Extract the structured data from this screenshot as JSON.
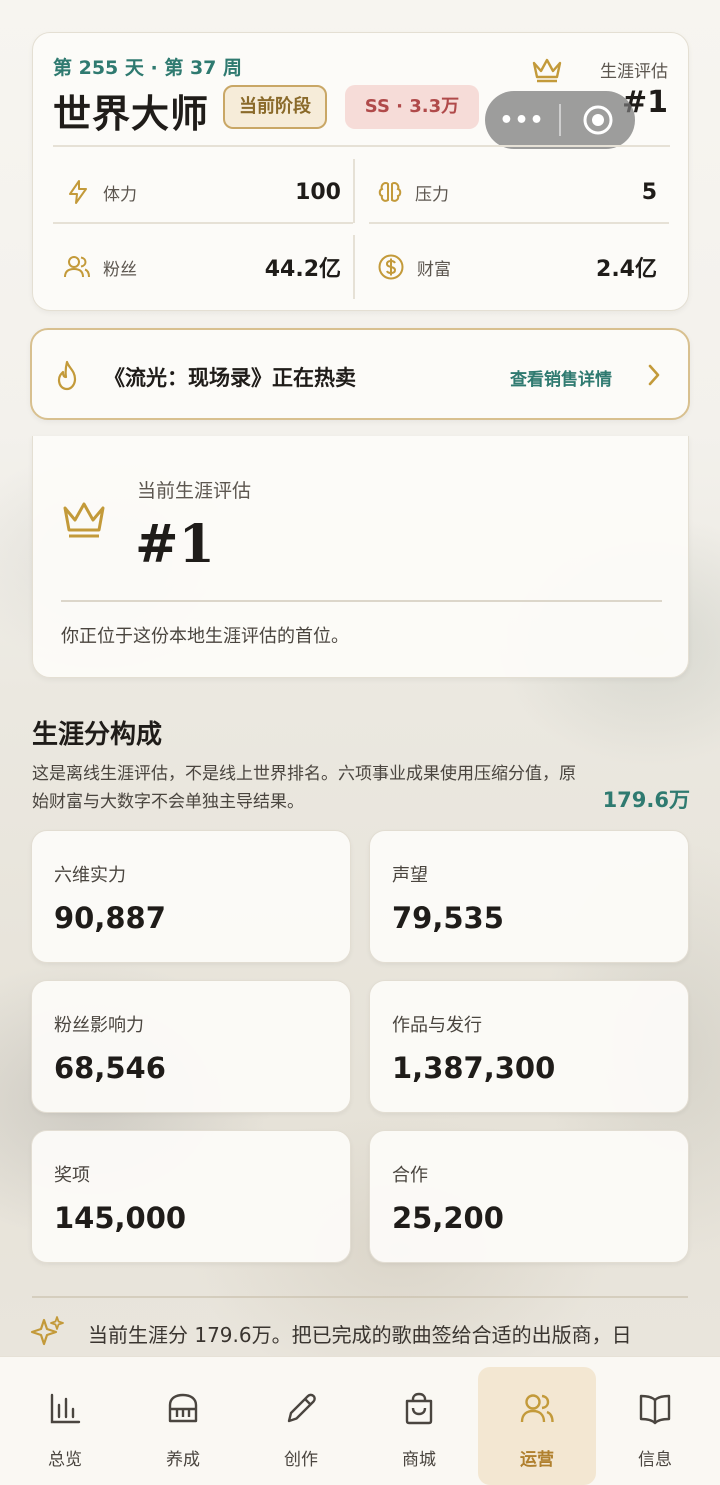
{
  "header": {
    "day_week": "第 255 天 · 第 37 周",
    "title": "世界大师",
    "stage_badge": "当前阶段",
    "ss_badge": "SS · 3.3万",
    "eval_label": "生涯评估",
    "eval_rank": "#1",
    "capsule_more": "•••"
  },
  "stats": [
    {
      "icon": "bolt-icon",
      "label": "体力",
      "value": "100"
    },
    {
      "icon": "brain-icon",
      "label": "压力",
      "value": "5"
    },
    {
      "icon": "users-icon",
      "label": "粉丝",
      "value": "44.2亿"
    },
    {
      "icon": "dollar-icon",
      "label": "财富",
      "value": "2.4亿"
    }
  ],
  "hot": {
    "text": "《流光：现场录》正在热卖",
    "link": "查看销售详情"
  },
  "career": {
    "label": "当前生涯评估",
    "rank": "#1",
    "note": "你正位于这份本地生涯评估的首位。"
  },
  "composition": {
    "title": "生涯分构成",
    "desc": "这是离线生涯评估，不是线上世界排名。六项事业成果使用压缩分值，原始财富与大数字不会单独主导结果。",
    "total": "179.6万",
    "tiles": [
      {
        "label": "六维实力",
        "value": "90,887"
      },
      {
        "label": "声望",
        "value": "79,535"
      },
      {
        "label": "粉丝影响力",
        "value": "68,546"
      },
      {
        "label": "作品与发行",
        "value": "1,387,300"
      },
      {
        "label": "奖项",
        "value": "145,000"
      },
      {
        "label": "合作",
        "value": "25,200"
      }
    ]
  },
  "marquee": "当前生涯分 179.6万。把已完成的歌曲签给合适的出版商，日",
  "nav": [
    {
      "icon": "chart-icon",
      "label": "总览"
    },
    {
      "icon": "piano-icon",
      "label": "养成"
    },
    {
      "icon": "pen-icon",
      "label": "创作"
    },
    {
      "icon": "bag-icon",
      "label": "商城"
    },
    {
      "icon": "users-icon",
      "label": "运营",
      "active": true
    },
    {
      "icon": "book-icon",
      "label": "信息"
    }
  ],
  "colors": {
    "accent": "#2f7a70",
    "gold": "#b0802e",
    "danger": "#b04a4a"
  }
}
